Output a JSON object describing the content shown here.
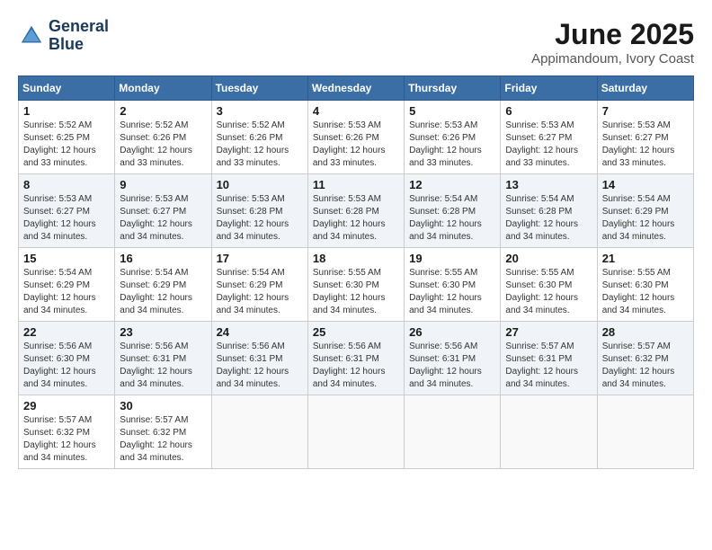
{
  "logo": {
    "line1": "General",
    "line2": "Blue"
  },
  "title": "June 2025",
  "location": "Appimandoum, Ivory Coast",
  "days_of_week": [
    "Sunday",
    "Monday",
    "Tuesday",
    "Wednesday",
    "Thursday",
    "Friday",
    "Saturday"
  ],
  "weeks": [
    [
      {
        "day": "1",
        "sunrise": "5:52 AM",
        "sunset": "6:25 PM",
        "daylight": "12 hours and 33 minutes."
      },
      {
        "day": "2",
        "sunrise": "5:52 AM",
        "sunset": "6:26 PM",
        "daylight": "12 hours and 33 minutes."
      },
      {
        "day": "3",
        "sunrise": "5:52 AM",
        "sunset": "6:26 PM",
        "daylight": "12 hours and 33 minutes."
      },
      {
        "day": "4",
        "sunrise": "5:53 AM",
        "sunset": "6:26 PM",
        "daylight": "12 hours and 33 minutes."
      },
      {
        "day": "5",
        "sunrise": "5:53 AM",
        "sunset": "6:26 PM",
        "daylight": "12 hours and 33 minutes."
      },
      {
        "day": "6",
        "sunrise": "5:53 AM",
        "sunset": "6:27 PM",
        "daylight": "12 hours and 33 minutes."
      },
      {
        "day": "7",
        "sunrise": "5:53 AM",
        "sunset": "6:27 PM",
        "daylight": "12 hours and 33 minutes."
      }
    ],
    [
      {
        "day": "8",
        "sunrise": "5:53 AM",
        "sunset": "6:27 PM",
        "daylight": "12 hours and 34 minutes."
      },
      {
        "day": "9",
        "sunrise": "5:53 AM",
        "sunset": "6:27 PM",
        "daylight": "12 hours and 34 minutes."
      },
      {
        "day": "10",
        "sunrise": "5:53 AM",
        "sunset": "6:28 PM",
        "daylight": "12 hours and 34 minutes."
      },
      {
        "day": "11",
        "sunrise": "5:53 AM",
        "sunset": "6:28 PM",
        "daylight": "12 hours and 34 minutes."
      },
      {
        "day": "12",
        "sunrise": "5:54 AM",
        "sunset": "6:28 PM",
        "daylight": "12 hours and 34 minutes."
      },
      {
        "day": "13",
        "sunrise": "5:54 AM",
        "sunset": "6:28 PM",
        "daylight": "12 hours and 34 minutes."
      },
      {
        "day": "14",
        "sunrise": "5:54 AM",
        "sunset": "6:29 PM",
        "daylight": "12 hours and 34 minutes."
      }
    ],
    [
      {
        "day": "15",
        "sunrise": "5:54 AM",
        "sunset": "6:29 PM",
        "daylight": "12 hours and 34 minutes."
      },
      {
        "day": "16",
        "sunrise": "5:54 AM",
        "sunset": "6:29 PM",
        "daylight": "12 hours and 34 minutes."
      },
      {
        "day": "17",
        "sunrise": "5:54 AM",
        "sunset": "6:29 PM",
        "daylight": "12 hours and 34 minutes."
      },
      {
        "day": "18",
        "sunrise": "5:55 AM",
        "sunset": "6:30 PM",
        "daylight": "12 hours and 34 minutes."
      },
      {
        "day": "19",
        "sunrise": "5:55 AM",
        "sunset": "6:30 PM",
        "daylight": "12 hours and 34 minutes."
      },
      {
        "day": "20",
        "sunrise": "5:55 AM",
        "sunset": "6:30 PM",
        "daylight": "12 hours and 34 minutes."
      },
      {
        "day": "21",
        "sunrise": "5:55 AM",
        "sunset": "6:30 PM",
        "daylight": "12 hours and 34 minutes."
      }
    ],
    [
      {
        "day": "22",
        "sunrise": "5:56 AM",
        "sunset": "6:30 PM",
        "daylight": "12 hours and 34 minutes."
      },
      {
        "day": "23",
        "sunrise": "5:56 AM",
        "sunset": "6:31 PM",
        "daylight": "12 hours and 34 minutes."
      },
      {
        "day": "24",
        "sunrise": "5:56 AM",
        "sunset": "6:31 PM",
        "daylight": "12 hours and 34 minutes."
      },
      {
        "day": "25",
        "sunrise": "5:56 AM",
        "sunset": "6:31 PM",
        "daylight": "12 hours and 34 minutes."
      },
      {
        "day": "26",
        "sunrise": "5:56 AM",
        "sunset": "6:31 PM",
        "daylight": "12 hours and 34 minutes."
      },
      {
        "day": "27",
        "sunrise": "5:57 AM",
        "sunset": "6:31 PM",
        "daylight": "12 hours and 34 minutes."
      },
      {
        "day": "28",
        "sunrise": "5:57 AM",
        "sunset": "6:32 PM",
        "daylight": "12 hours and 34 minutes."
      }
    ],
    [
      {
        "day": "29",
        "sunrise": "5:57 AM",
        "sunset": "6:32 PM",
        "daylight": "12 hours and 34 minutes."
      },
      {
        "day": "30",
        "sunrise": "5:57 AM",
        "sunset": "6:32 PM",
        "daylight": "12 hours and 34 minutes."
      },
      null,
      null,
      null,
      null,
      null
    ]
  ]
}
